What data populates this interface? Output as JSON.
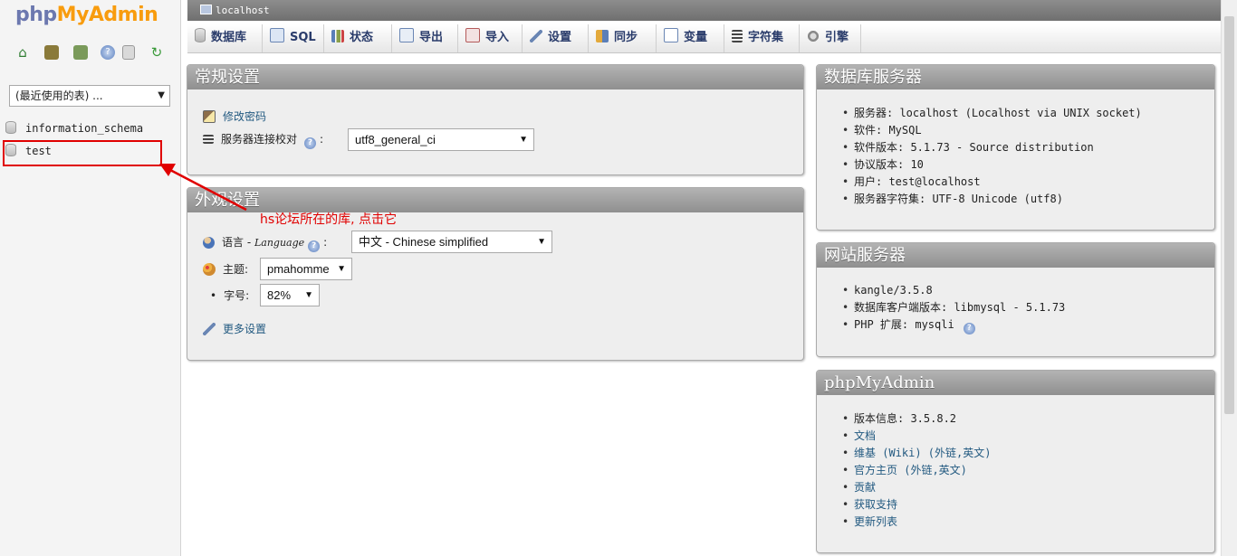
{
  "logo": {
    "php": "php",
    "my": "My",
    "admin": "Admin"
  },
  "nav_icons": [
    "home-icon",
    "logout-icon",
    "sql-query-icon",
    "help-icon",
    "docs-icon",
    "reload-icon"
  ],
  "recent_select": {
    "value": "(最近使用的表) ..."
  },
  "databases": [
    "information_schema",
    "test"
  ],
  "server_bar": {
    "label": "localhost"
  },
  "tabs": [
    {
      "label": "数据库",
      "icon": "database-icon"
    },
    {
      "label": "SQL",
      "icon": "sql-icon"
    },
    {
      "label": "状态",
      "icon": "status-icon"
    },
    {
      "label": "导出",
      "icon": "export-icon"
    },
    {
      "label": "导入",
      "icon": "import-icon"
    },
    {
      "label": "设置",
      "icon": "settings-icon"
    },
    {
      "label": "同步",
      "icon": "sync-icon"
    },
    {
      "label": "变量",
      "icon": "variables-icon"
    },
    {
      "label": "字符集",
      "icon": "charset-icon"
    },
    {
      "label": "引擎",
      "icon": "engine-icon"
    }
  ],
  "general_settings": {
    "title": "常规设置",
    "change_password": "修改密码",
    "collation_label": "服务器连接校对",
    "collation_value": "utf8_general_ci"
  },
  "appearance_settings": {
    "title": "外观设置",
    "language_label": "语言 - ",
    "language_label_en": "Language",
    "language_value": "中文 - Chinese simplified",
    "theme_label": "主题:",
    "theme_value": "pmahomme",
    "font_size_label": "字号:",
    "font_size_value": "82%",
    "more_settings": "更多设置"
  },
  "db_server": {
    "title": "数据库服务器",
    "items": [
      "服务器: localhost (Localhost via UNIX socket)",
      "软件: MySQL",
      "软件版本: 5.1.73 - Source distribution",
      "协议版本: 10",
      "用户: test@localhost",
      "服务器字符集: UTF-8 Unicode (utf8)"
    ]
  },
  "web_server": {
    "title": "网站服务器",
    "items": [
      "kangle/3.5.8",
      "数据库客户端版本: libmysql - 5.1.73",
      "PHP 扩展: mysqli"
    ]
  },
  "pma_info": {
    "title": "phpMyAdmin",
    "version": "版本信息: 3.5.8.2",
    "links": [
      "文档",
      "维基 (Wiki) (外链,英文)",
      "官方主页 (外链,英文)",
      "贡献",
      "获取支持",
      "更新列表"
    ]
  },
  "annotation": {
    "text": "hs论坛所在的库, 点击它",
    "color": "#e00000"
  }
}
